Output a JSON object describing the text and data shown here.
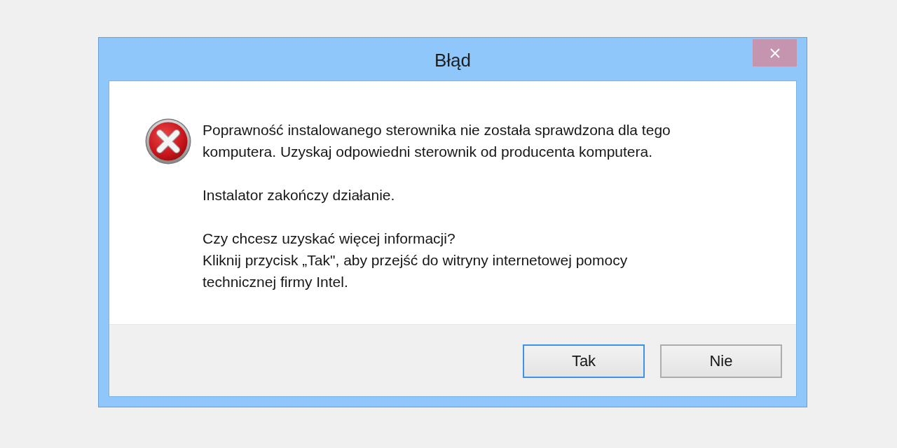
{
  "window": {
    "title": "Błąd"
  },
  "message": {
    "paragraphs": [
      {
        "lines": [
          "Poprawność instalowanego sterownika nie została sprawdzona dla tego",
          "komputera. Uzyskaj odpowiedni sterownik od producenta komputera."
        ]
      },
      {
        "lines": [
          "Instalator zakończy działanie."
        ]
      },
      {
        "lines": [
          "Czy chcesz uzyskać więcej informacji?",
          "Kliknij przycisk „Tak\", aby przejść do witryny internetowej pomocy",
          "technicznej firmy Intel."
        ]
      }
    ]
  },
  "buttons": [
    {
      "label": "Tak",
      "default": true
    },
    {
      "label": "Nie",
      "default": false
    }
  ]
}
